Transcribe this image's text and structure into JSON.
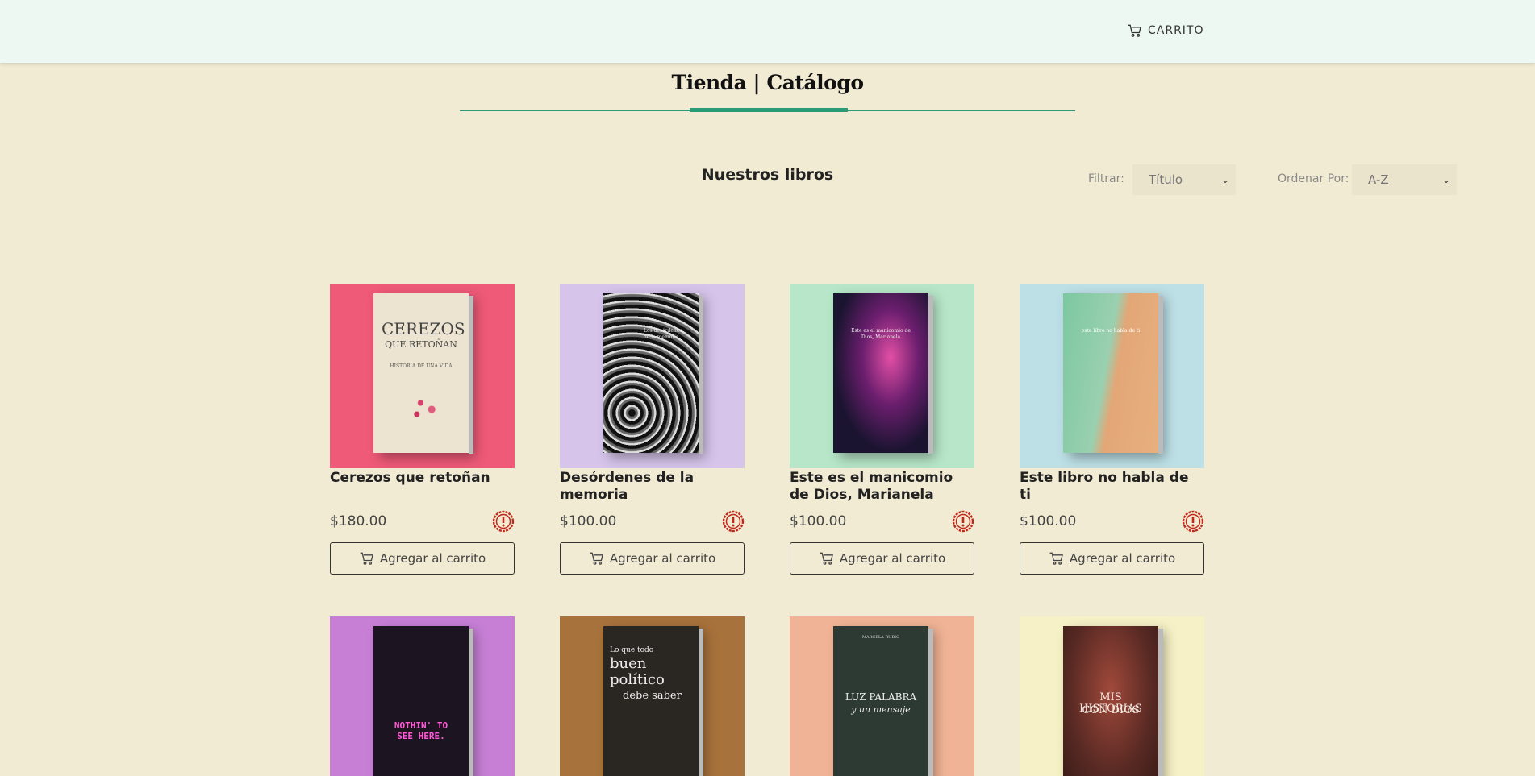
{
  "header": {
    "cart_label": "CARRITO"
  },
  "page": {
    "title": "Tienda | Catálogo",
    "subtitle": "Nuestros libros",
    "filter_label": "Filtrar:",
    "filter_value": "Título",
    "sort_label": "Ordenar Por:",
    "sort_value": "A-Z"
  },
  "colors": {
    "accent": "#2a9a79",
    "background": "#f2ebd3",
    "header_bg": "#eef8f3",
    "warning": "#c0281b"
  },
  "products": [
    {
      "title": "Cerezos que retoñan",
      "price": "$180.00",
      "button": "Agregar al carrito",
      "cover_bg": "#ee5a78",
      "book_color": "#ece4d0",
      "cover_text": [
        "CEREZOS",
        "QUE RETOÑAN",
        "HISTORIA DE UNA VIDA"
      ]
    },
    {
      "title": "Desórdenes de la memoria",
      "price": "$100.00",
      "button": "Agregar al carrito",
      "cover_bg": "#d6c4ea",
      "book_color": "#3a3a3a",
      "cover_text": [
        "Los desórdenes",
        "de la memoria"
      ]
    },
    {
      "title": "Este es el manicomio de Dios, Marianela",
      "price": "$100.00",
      "button": "Agregar al carrito",
      "cover_bg": "#b7e6c8",
      "book_color": "#3a1a4e",
      "cover_text": [
        "Este es el manicomio de",
        "Dios, Marianela"
      ]
    },
    {
      "title": "Este libro no habla de ti",
      "price": "$100.00",
      "button": "Agregar al carrito",
      "cover_bg": "#bce0e6",
      "book_color": "#6fbf9a",
      "cover_text": [
        "este libro no habla de ti"
      ]
    },
    {
      "title": "",
      "price": "",
      "button": "",
      "cover_bg": "#c77fd6",
      "book_color": "#1c1420",
      "cover_text": [
        "NOTHIN' TO",
        "SEE HERE."
      ]
    },
    {
      "title": "",
      "price": "",
      "button": "",
      "cover_bg": "#a8723c",
      "book_color": "#2a2622",
      "cover_text": [
        "Lo que todo",
        "buen",
        "político",
        "debe saber"
      ]
    },
    {
      "title": "",
      "price": "",
      "button": "",
      "cover_bg": "#f0b395",
      "book_color": "#2d3a34",
      "cover_text": [
        "MARCELA RUBIO",
        "LUZ PALABRA",
        "y un mensaje"
      ]
    },
    {
      "title": "",
      "price": "",
      "button": "",
      "cover_bg": "#f6f1c6",
      "book_color": "#5a2a24",
      "cover_text": [
        "MIS HISTORIAS",
        "CON DIOS"
      ]
    }
  ]
}
